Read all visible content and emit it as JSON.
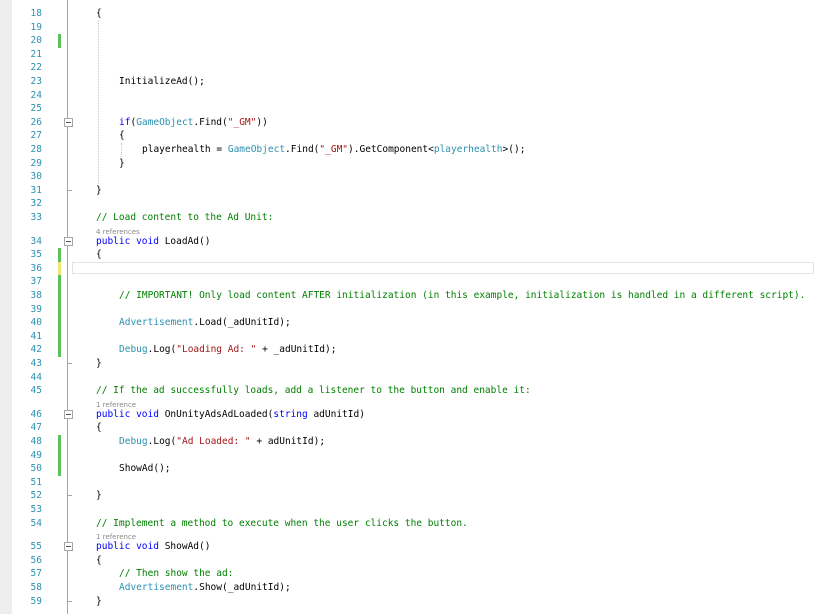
{
  "editor": {
    "colors": {
      "line_number": "#2b91af",
      "keyword": "#0000ff",
      "type": "#2b91af",
      "string": "#a31515",
      "comment": "#008000",
      "plain": "#000000",
      "codelens": "#8a8a8a",
      "change_saved": "#5cc15c",
      "change_unsaved": "#efe476"
    },
    "lines": [
      {
        "n": "18",
        "code": "{"
      },
      {
        "n": "19",
        "code": ""
      },
      {
        "n": "20",
        "code": "",
        "mark": "saved"
      },
      {
        "n": "21",
        "code": ""
      },
      {
        "n": "22",
        "code": ""
      },
      {
        "n": "23",
        "code": "InitializeAd();"
      },
      {
        "n": "24",
        "code": ""
      },
      {
        "n": "25",
        "code": ""
      },
      {
        "n": "26",
        "code": "if(GameObject.Find(\"_GM\"))",
        "fold": true
      },
      {
        "n": "27",
        "code": "{"
      },
      {
        "n": "28",
        "code": "playerhealth = GameObject.Find(\"_GM\").GetComponent<playerhealth>();"
      },
      {
        "n": "29",
        "code": "}"
      },
      {
        "n": "30",
        "code": ""
      },
      {
        "n": "31",
        "code": "}"
      },
      {
        "n": "32",
        "code": ""
      },
      {
        "n": "33",
        "code": "// Load content to the Ad Unit:"
      },
      {
        "n": "34",
        "code": "public void LoadAd()",
        "fold": true,
        "refs": "4 references"
      },
      {
        "n": "35",
        "code": "{",
        "mark": "saved"
      },
      {
        "n": "36",
        "code": "",
        "mark": "unsaved"
      },
      {
        "n": "37",
        "code": "",
        "mark": "saved"
      },
      {
        "n": "38",
        "code": "// IMPORTANT! Only load content AFTER initialization (in this example, initialization is handled in a different script).",
        "mark": "saved"
      },
      {
        "n": "39",
        "code": "",
        "mark": "saved"
      },
      {
        "n": "40",
        "code": "Advertisement.Load(_adUnitId);",
        "mark": "saved"
      },
      {
        "n": "41",
        "code": "",
        "mark": "saved"
      },
      {
        "n": "42",
        "code": "Debug.Log(\"Loading Ad: \" + _adUnitId);",
        "mark": "saved"
      },
      {
        "n": "43",
        "code": "}"
      },
      {
        "n": "44",
        "code": ""
      },
      {
        "n": "45",
        "code": "// If the ad successfully loads, add a listener to the button and enable it:"
      },
      {
        "n": "46",
        "code": "public void OnUnityAdsAdLoaded(string adUnitId)",
        "fold": true,
        "refs": "1 reference"
      },
      {
        "n": "47",
        "code": "{"
      },
      {
        "n": "48",
        "code": "Debug.Log(\"Ad Loaded: \" + adUnitId);",
        "mark": "saved"
      },
      {
        "n": "49",
        "code": "",
        "mark": "saved"
      },
      {
        "n": "50",
        "code": "ShowAd();",
        "mark": "saved"
      },
      {
        "n": "51",
        "code": ""
      },
      {
        "n": "52",
        "code": "}"
      },
      {
        "n": "53",
        "code": ""
      },
      {
        "n": "54",
        "code": "// Implement a method to execute when the user clicks the button."
      },
      {
        "n": "55",
        "code": "public void ShowAd()",
        "fold": true,
        "refs": "1 reference"
      },
      {
        "n": "56",
        "code": "{"
      },
      {
        "n": "57",
        "code": "// Then show the ad:"
      },
      {
        "n": "58",
        "code": "Advertisement.Show(_adUnitId);"
      },
      {
        "n": "59",
        "code": "}"
      }
    ]
  }
}
